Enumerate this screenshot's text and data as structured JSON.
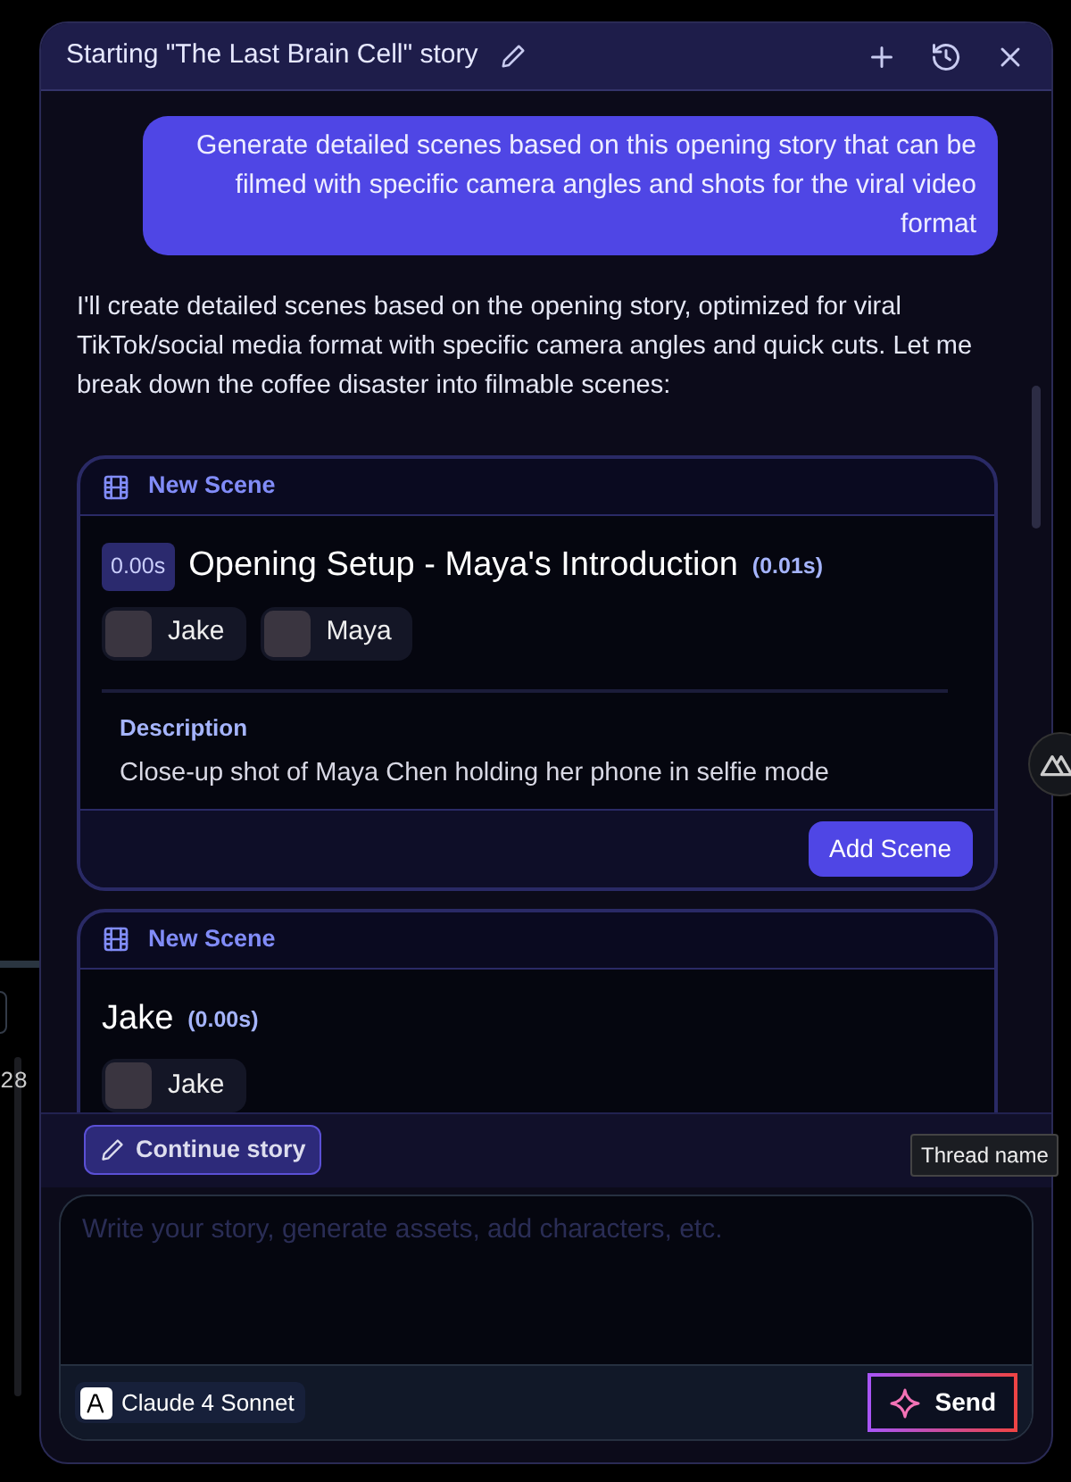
{
  "thread": {
    "title": "Starting \"The Last Brain Cell\" story"
  },
  "messages": [
    {
      "kind": "user",
      "text": "Generate detailed scenes based on this opening story that can be filmed with specific camera angles and shots for the viral video format"
    },
    {
      "kind": "assistant",
      "text": "I'll create detailed scenes based on the opening story, optimized for viral TikTok/social media format with specific camera angles and quick cuts. Let me break down the coffee disaster into filmable scenes:"
    }
  ],
  "scenes": [
    {
      "header": "New Scene",
      "start": "0.00s",
      "title": "Opening Setup - Maya's Introduction",
      "duration": "(0.01s)",
      "characters": [
        {
          "name": "Jake"
        },
        {
          "name": "Maya"
        }
      ],
      "description_label": "Description",
      "description": "Close-up shot of Maya Chen holding her phone in selfie mode",
      "button": "Add Scene"
    },
    {
      "header": "New Scene",
      "title": "Jake",
      "duration": "(0.00s)",
      "characters": [
        {
          "name": "Jake"
        }
      ]
    }
  ],
  "composer": {
    "action": "Continue story",
    "placeholder": "Write your story, generate assets, add characters, etc.",
    "model": "Claude 4 Sonnet",
    "send": "Send"
  },
  "tooltip": "Thread name",
  "background": {
    "number": "28"
  }
}
